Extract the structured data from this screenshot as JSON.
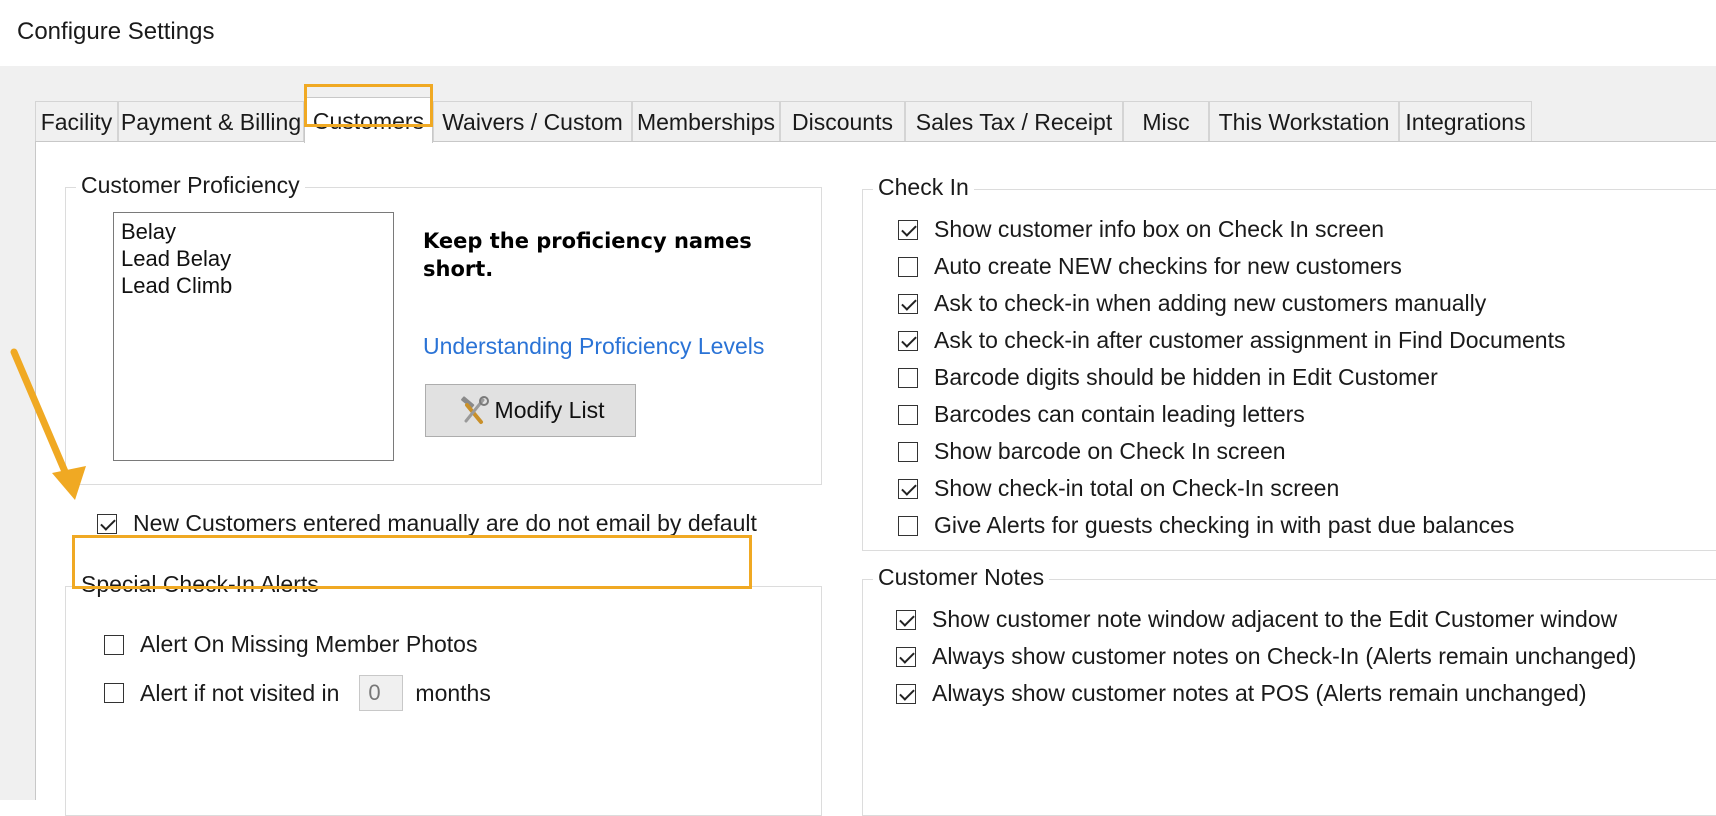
{
  "window": {
    "title": "Configure Settings"
  },
  "tabs": [
    {
      "label": "Facility",
      "active": false
    },
    {
      "label": "Payment & Billing",
      "active": false
    },
    {
      "label": "Customers",
      "active": true
    },
    {
      "label": "Waivers / Custom",
      "active": false
    },
    {
      "label": "Memberships",
      "active": false
    },
    {
      "label": "Discounts",
      "active": false
    },
    {
      "label": "Sales Tax / Receipt",
      "active": false
    },
    {
      "label": "Misc",
      "active": false
    },
    {
      "label": "This Workstation",
      "active": false
    },
    {
      "label": "Integrations",
      "active": false
    }
  ],
  "proficiency": {
    "group_label": "Customer Proficiency",
    "items": [
      "Belay",
      "Lead Belay",
      "Lead Climb"
    ],
    "hint": "Keep the proficiency names short.",
    "link": "Understanding Proficiency Levels",
    "modify_button": "Modify List",
    "modify_icon": "tools-icon"
  },
  "default_email": {
    "label": "New Customers entered manually are do not email by default",
    "checked": true
  },
  "special_alerts": {
    "group_label": "Special Check-In Alerts",
    "missing_photos": {
      "label": "Alert On Missing Member Photos",
      "checked": false
    },
    "not_visited": {
      "label_before": "Alert if not visited in",
      "value": "0",
      "label_after": "months",
      "checked": false
    }
  },
  "check_in": {
    "group_label": "Check In",
    "options": [
      {
        "label": "Show customer info box on Check In screen",
        "checked": true
      },
      {
        "label": "Auto create NEW checkins for new customers",
        "checked": false
      },
      {
        "label": "Ask to check-in when adding new customers manually",
        "checked": true
      },
      {
        "label": "Ask to check-in after customer assignment in Find Documents",
        "checked": true
      },
      {
        "label": "Barcode digits should be hidden in Edit Customer",
        "checked": false
      },
      {
        "label": "Barcodes can contain leading letters",
        "checked": false
      },
      {
        "label": "Show barcode on Check In screen",
        "checked": false
      },
      {
        "label": "Show check-in total on Check-In screen",
        "checked": true
      },
      {
        "label": "Give Alerts for guests checking in with past due balances",
        "checked": false
      }
    ]
  },
  "customer_notes": {
    "group_label": "Customer Notes",
    "options": [
      {
        "label": "Show customer note window adjacent to the Edit Customer window",
        "checked": true
      },
      {
        "label": "Always show customer notes on Check-In (Alerts remain unchanged)",
        "checked": true
      },
      {
        "label": "Always show customer notes at POS (Alerts remain unchanged)",
        "checked": true
      }
    ]
  },
  "colors": {
    "highlight": "#f0a923",
    "link": "#2a73d6"
  }
}
